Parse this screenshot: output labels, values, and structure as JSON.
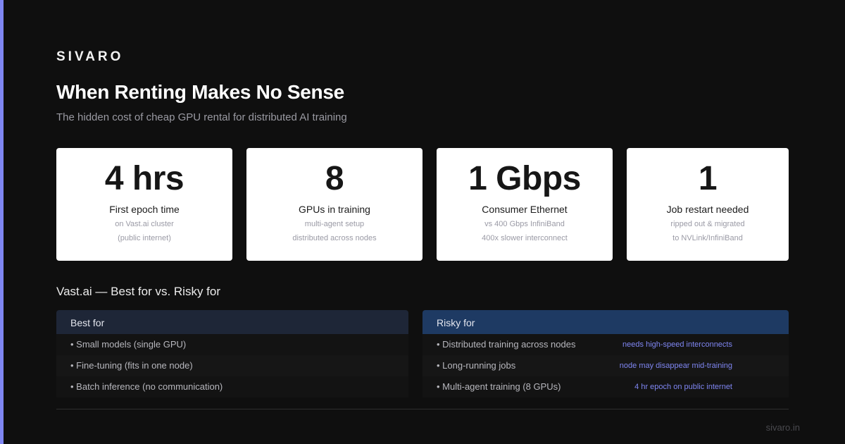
{
  "brand": "SIVARO",
  "title": "When Renting Makes No Sense",
  "subtitle": "The hidden cost of cheap GPU rental for distributed AI training",
  "colors": {
    "accent": "#7f86f2",
    "background": "#0f0f0f",
    "best_header": "#1e2637",
    "risky_header": "#1e3a63"
  },
  "stats": [
    {
      "value": "4 hrs",
      "label": "First epoch time",
      "note1": "on Vast.ai cluster",
      "note2": "(public internet)"
    },
    {
      "value": "8",
      "label": "GPUs in training",
      "note1": "multi-agent setup",
      "note2": "distributed across nodes"
    },
    {
      "value": "1 Gbps",
      "label": "Consumer Ethernet",
      "note1": "vs 400 Gbps InfiniBand",
      "note2": "400x slower interconnect"
    },
    {
      "value": "1",
      "label": "Job restart needed",
      "note1": "ripped out & migrated",
      "note2": "to NVLink/InfiniBand"
    }
  ],
  "comparison": {
    "title": "Vast.ai — Best for vs. Risky for",
    "best": {
      "header": "Best for",
      "items": [
        {
          "text": "• Small models (single GPU)"
        },
        {
          "text": "• Fine-tuning (fits in one node)"
        },
        {
          "text": "• Batch inference (no communication)"
        }
      ]
    },
    "risky": {
      "header": "Risky for",
      "items": [
        {
          "text": "• Distributed training across nodes",
          "note": "needs high-speed interconnects"
        },
        {
          "text": "• Long-running jobs",
          "note": "node may disappear mid-training"
        },
        {
          "text": "• Multi-agent training (8 GPUs)",
          "note": "4 hr epoch on public internet"
        }
      ]
    }
  },
  "footer": "sivaro.in"
}
